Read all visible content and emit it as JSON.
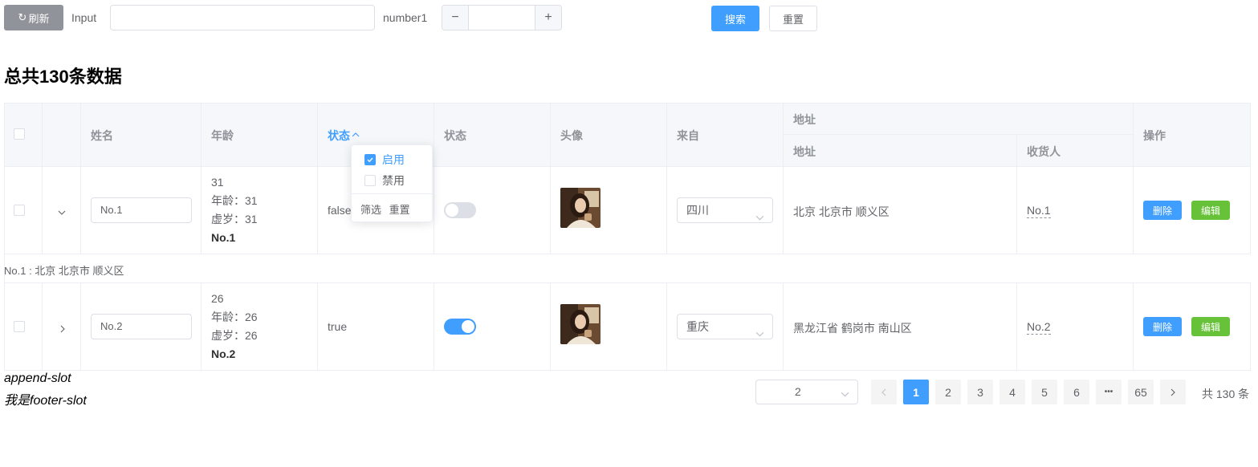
{
  "toolbar": {
    "refresh_label": "刷新",
    "input_label": "Input",
    "input_value": "",
    "number_label": "number1",
    "number_value": "",
    "search_label": "搜索",
    "reset_label": "重置"
  },
  "heading": "总共130条数据",
  "table": {
    "headers": {
      "name": "姓名",
      "age": "年龄",
      "status_filter": "状态",
      "status": "状态",
      "avatar": "头像",
      "from": "来自",
      "address_group": "地址",
      "address": "地址",
      "receiver": "收货人",
      "actions": "操作"
    },
    "rows": [
      {
        "name": "No.1",
        "age": "31",
        "age_line": "年龄：31",
        "nominal_line": "虚岁：31",
        "bold": "No.1",
        "status_text": "false",
        "switch_on": false,
        "from": "四川",
        "address": "北京 北京市 顺义区",
        "receiver": "No.1",
        "delete_label": "删除",
        "edit_label": "编辑"
      },
      {
        "name": "No.2",
        "age": "26",
        "age_line": "年龄：26",
        "nominal_line": "虚岁：26",
        "bold": "No.2",
        "status_text": "true",
        "switch_on": true,
        "from": "重庆",
        "address": "黑龙江省 鹤岗市 南山区",
        "receiver": "No.2",
        "delete_label": "删除",
        "edit_label": "编辑"
      }
    ],
    "expanded_text": "No.1 : 北京 北京市 顺义区"
  },
  "filter": {
    "options": [
      {
        "label": "启用",
        "checked": true
      },
      {
        "label": "禁用",
        "checked": false
      }
    ],
    "confirm_label": "筛选",
    "reset_label": "重置"
  },
  "slots": {
    "append": "append-slot",
    "footer": "我是footer-slot"
  },
  "pagination": {
    "page_size": "2",
    "pages": [
      "1",
      "2",
      "3",
      "4",
      "5",
      "6"
    ],
    "current": "1",
    "ellipsis": "•••",
    "last": "65",
    "total": "共 130 条"
  },
  "colors": {
    "primary": "#409eff",
    "success": "#67c23a",
    "info": "#909399"
  }
}
